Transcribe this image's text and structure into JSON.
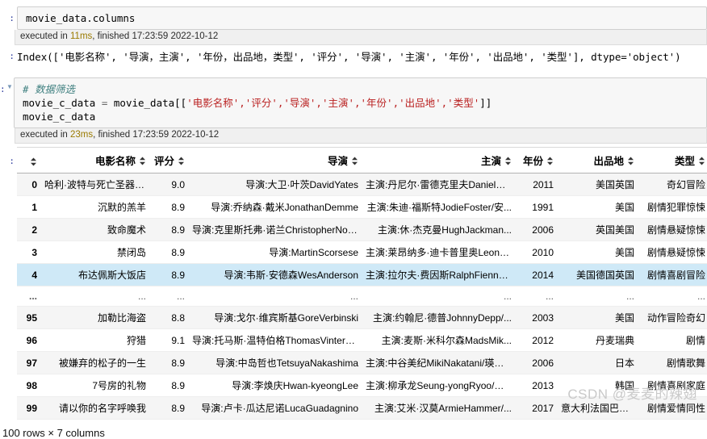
{
  "cells": [
    {
      "prompt": ":",
      "code_html": "movie_data.columns",
      "exec_prefix": "executed in ",
      "exec_ms": "11ms",
      "exec_suffix": ", finished 17:23:59 2022-10-12"
    }
  ],
  "cell1": {
    "prompt": ":",
    "code": "movie_data.columns",
    "exec_line": "executed in 11ms, finished 17:23:59 2022-10-12",
    "exec_ms": "11ms",
    "exec_head": "executed in ",
    "exec_tail": ", finished 17:23:59 2022-10-12"
  },
  "output1": {
    "prompt": ":",
    "text": "Index(['电影名称', '导演，主演', '年份，出品地，类型', '评分', '导演', '主演', '年份', '出品地', '类型'], dtype='object')"
  },
  "cell2": {
    "prompt": ":",
    "collapse_glyph": "▼",
    "comment": "# 数据筛选",
    "line2_a": "movie_c_data ",
    "line2_op": "=",
    "line2_b": " movie_data[[",
    "line2_strs": "'电影名称','评分','导演','主演','年份','出品地','类型'",
    "line2_c": "]]",
    "line3": "movie_c_data",
    "exec_head": "executed in ",
    "exec_ms": "23ms",
    "exec_tail": ", finished 17:23:59 2022-10-12"
  },
  "output2": {
    "prompt": ":",
    "table": {
      "index_header": "",
      "columns": [
        "电影名称",
        "评分",
        "导演",
        "主演",
        "年份",
        "出品地",
        "类型"
      ],
      "rows": [
        {
          "index": "0",
          "cells": [
            "哈利·波特与死亡圣器(下)",
            "9.0",
            "导演:大卫·叶茨DavidYates",
            "主演:丹尼尔·雷德克里夫DanielRadcliffe...",
            "2011",
            "美国英国",
            "奇幻冒险"
          ]
        },
        {
          "index": "1",
          "cells": [
            "沉默的羔羊",
            "8.9",
            "导演:乔纳森·戴米JonathanDemme",
            "主演:朱迪·福斯特JodieFoster/安...",
            "1991",
            "美国",
            "剧情犯罪惊悚"
          ]
        },
        {
          "index": "2",
          "cells": [
            "致命魔术",
            "8.9",
            "导演:克里斯托弗·诺兰ChristopherNolan",
            "主演:休·杰克曼HughJackman...",
            "2006",
            "英国美国",
            "剧情悬疑惊悚"
          ]
        },
        {
          "index": "3",
          "cells": [
            "禁闭岛",
            "8.9",
            "导演:MartinScorsese",
            "主演:莱昂纳多·迪卡普里奥LeonardoDiCaprio/...",
            "2010",
            "美国",
            "剧情悬疑惊悚"
          ]
        },
        {
          "index": "4",
          "cells": [
            "布达佩斯大饭店",
            "8.9",
            "导演:韦斯·安德森WesAnderson",
            "主演:拉尔夫·费因斯RalphFiennes/...",
            "2014",
            "美国德国英国",
            "剧情喜剧冒险"
          ],
          "selected": true
        },
        {
          "index": "...",
          "cells": [
            "...",
            "...",
            "...",
            "...",
            "...",
            "...",
            "..."
          ],
          "ellipsis": true
        },
        {
          "index": "95",
          "cells": [
            "加勒比海盗",
            "8.8",
            "导演:戈尔·维宾斯基GoreVerbinski",
            "主演:约翰尼·德普JohnnyDepp/...",
            "2003",
            "美国",
            "动作冒险奇幻"
          ]
        },
        {
          "index": "96",
          "cells": [
            "狩猎",
            "9.1",
            "导演:托马斯·温特伯格ThomasVinterberg",
            "主演:麦斯·米科尔森MadsMik...",
            "2012",
            "丹麦瑞典",
            "剧情"
          ]
        },
        {
          "index": "97",
          "cells": [
            "被嫌弃的松子的一生",
            "8.9",
            "导演:中岛哲也TetsuyaNakashima",
            "主演:中谷美纪MikiNakatani/瑛太E...",
            "2006",
            "日本",
            "剧情歌舞"
          ]
        },
        {
          "index": "98",
          "cells": [
            "7号房的礼物",
            "8.9",
            "导演:李焕庆Hwan-kyeongLee",
            "主演:柳承龙Seung-yongRyoo/朴信惠Shi...",
            "2013",
            "韩国",
            "剧情喜剧家庭"
          ]
        },
        {
          "index": "99",
          "cells": [
            "请以你的名字呼唤我",
            "8.9",
            "导演:卢卡·瓜达尼诺LucaGuadagnino",
            "主演:艾米·汉莫ArmieHammer/...",
            "2017",
            "意大利法国巴西美国",
            "剧情爱情同性"
          ]
        }
      ]
    },
    "shape_text": "100 rows × 7 columns"
  },
  "watermark": "CSDN @麦麦的辣翅",
  "colors": {
    "selected_row": "#cfe9f7",
    "string_literal": "#BA2121",
    "comment": "#408080",
    "prompt": "#303F9F"
  }
}
